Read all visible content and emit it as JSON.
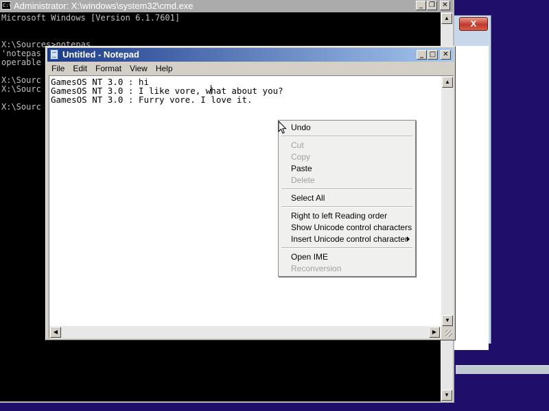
{
  "cmd": {
    "title": "Administrator: X:\\windows\\system32\\cmd.exe",
    "icon_label": "C:\\",
    "lines": [
      "Microsoft Windows [Version 6.1.7601]",
      "",
      "",
      "X:\\Sources>notepas",
      "'notepas",
      "operable",
      "",
      "X:\\Sourc",
      "X:\\Sourc",
      "",
      "",
      "X:\\Sourc"
    ]
  },
  "background_window": {
    "close_glyph": "X"
  },
  "notepad": {
    "title": "Untitled - Notepad",
    "menu": [
      "File",
      "Edit",
      "Format",
      "View",
      "Help"
    ],
    "lines": [
      "GamesOS NT 3.0 : hi",
      "GamesOS NT 3.0 : I like vore, what about you?",
      "GamesOS NT 3.0 : Furry vore. I love it."
    ]
  },
  "caption_buttons": {
    "minimize": "_",
    "maximize": "□",
    "restore": "❐",
    "close": "✕"
  },
  "context_menu": {
    "items": [
      {
        "label": "Undo",
        "enabled": true
      },
      {
        "label": "Cut",
        "enabled": false
      },
      {
        "label": "Copy",
        "enabled": false
      },
      {
        "label": "Paste",
        "enabled": true
      },
      {
        "label": "Delete",
        "enabled": false
      },
      {
        "label": "Select All",
        "enabled": true
      },
      {
        "label": "Right to left Reading order",
        "enabled": true
      },
      {
        "label": "Show Unicode control characters",
        "enabled": true
      },
      {
        "label": "Insert Unicode control character",
        "enabled": true,
        "submenu": true
      },
      {
        "label": "Open IME",
        "enabled": true
      },
      {
        "label": "Reconversion",
        "enabled": false
      }
    ]
  },
  "scroll_glyphs": {
    "up": "▲",
    "down": "▼",
    "left": "◀",
    "right": "▶"
  },
  "colors": {
    "desktop": "#1f0f6b",
    "notepad_title_start": "#1a3a8a",
    "notepad_title_end": "#a5c6ee",
    "cmd_text": "#c0c0c0"
  }
}
